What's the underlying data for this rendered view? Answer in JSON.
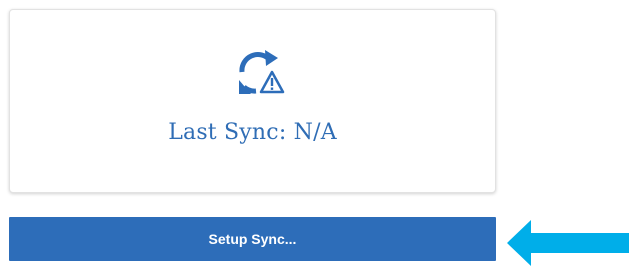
{
  "sync_card": {
    "status_icon": "sync-warning-icon",
    "status_text": "Last Sync: N/A"
  },
  "setup_button": {
    "label": "Setup Sync..."
  },
  "pointer": {
    "icon": "arrow-left-icon",
    "color": "#00aee9"
  },
  "colors": {
    "accent": "#2d6db9",
    "text_blue": "#2f6db5"
  }
}
